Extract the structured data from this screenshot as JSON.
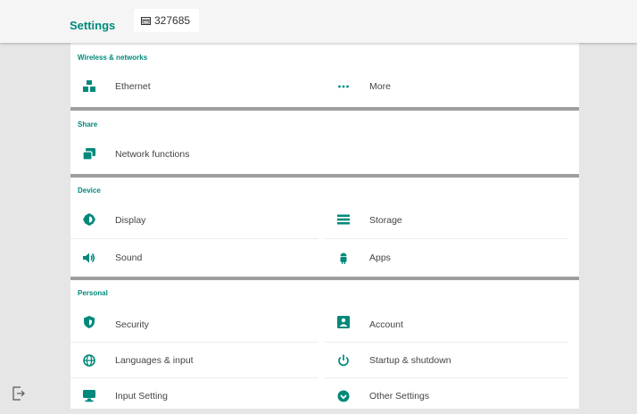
{
  "header": {
    "title": "Settings",
    "tab_label": "327685"
  },
  "colors": {
    "accent": "#00897b",
    "background": "#e6e6e6",
    "divider": "#9e9e9e"
  },
  "sections": {
    "wireless": {
      "title": "Wireless & networks",
      "ethernet": {
        "label": "Ethernet",
        "icon": "ethernet-icon"
      },
      "more": {
        "label": "More",
        "icon": "more-dots-icon"
      }
    },
    "share": {
      "title": "Share",
      "network_functions": {
        "label": "Network functions",
        "icon": "network-functions-icon"
      }
    },
    "device": {
      "title": "Device",
      "display": {
        "label": "Display",
        "icon": "display-brightness-icon"
      },
      "storage": {
        "label": "Storage",
        "icon": "storage-icon"
      },
      "sound": {
        "label": "Sound",
        "icon": "sound-icon"
      },
      "apps": {
        "label": "Apps",
        "icon": "apps-android-icon"
      }
    },
    "personal": {
      "title": "Personal",
      "security": {
        "label": "Security",
        "icon": "security-shield-icon"
      },
      "account": {
        "label": "Account",
        "icon": "account-icon"
      },
      "languages": {
        "label": "Languages & input",
        "icon": "globe-icon"
      },
      "startup": {
        "label": "Startup & shutdown",
        "icon": "power-icon"
      },
      "input_setting": {
        "label": "Input Setting",
        "icon": "input-setting-icon"
      },
      "other_settings": {
        "label": "Other Settings",
        "icon": "other-settings-icon"
      }
    }
  }
}
